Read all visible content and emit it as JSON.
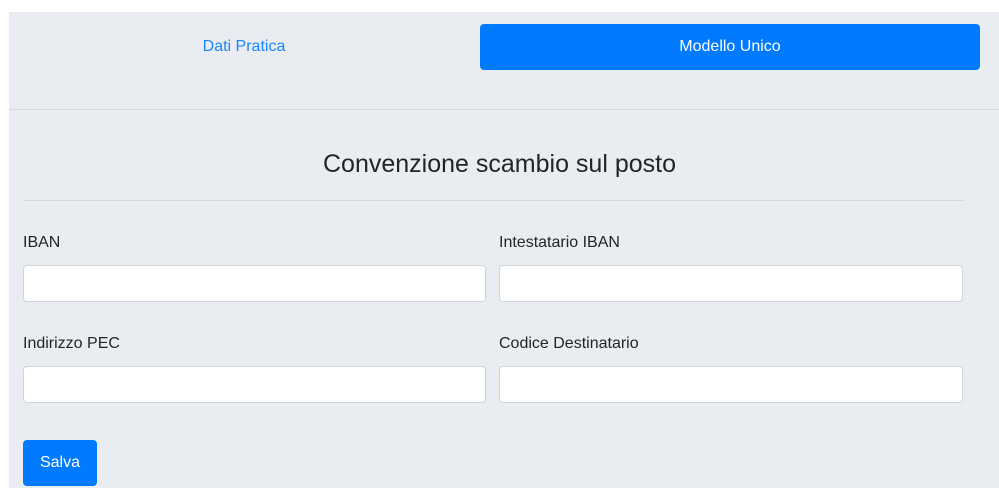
{
  "tabs": {
    "dati_pratica": "Dati Pratica",
    "modello_unico": "Modello Unico"
  },
  "form": {
    "title": "Convenzione scambio sul posto",
    "iban_label": "IBAN",
    "iban_value": "",
    "intestatario_label": "Intestatario IBAN",
    "intestatario_value": "",
    "pec_label": "Indirizzo PEC",
    "pec_value": "",
    "codice_label": "Codice Destinatario",
    "codice_value": "",
    "save_label": "Salva"
  },
  "colors": {
    "accent": "#007bff",
    "panel_bg": "#e9edf1",
    "link": "#1a85ff"
  }
}
